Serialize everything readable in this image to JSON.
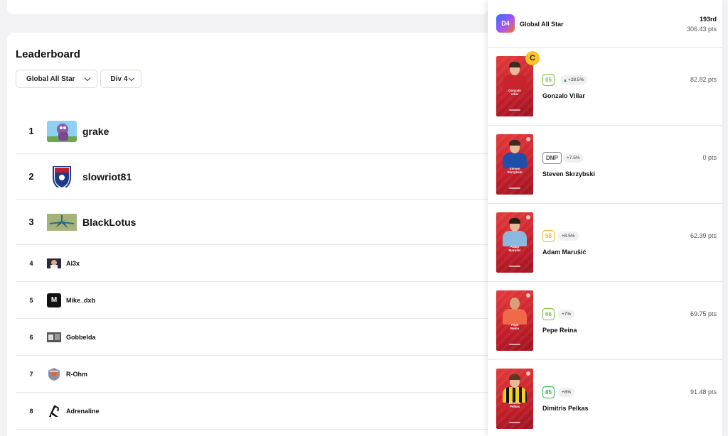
{
  "leaderboard": {
    "title": "Leaderboard",
    "filters": {
      "competition": "Global All Star",
      "division": "Div 4"
    },
    "rows": [
      {
        "rank": "1",
        "name": "grake"
      },
      {
        "rank": "2",
        "name": "slowriot81"
      },
      {
        "rank": "3",
        "name": "BlackLotus"
      },
      {
        "rank": "4",
        "name": "Al3x"
      },
      {
        "rank": "5",
        "name": "Mike_dxb",
        "avatar_letter": "M"
      },
      {
        "rank": "6",
        "name": "Gobbelda"
      },
      {
        "rank": "7",
        "name": "R-Ohm"
      },
      {
        "rank": "8",
        "name": "Adrenaline"
      }
    ]
  },
  "panel": {
    "badge": "D4",
    "competition": "Global All Star",
    "rank": "193rd",
    "points": "306.43 pts",
    "captain_label": "C",
    "players": [
      {
        "name": "Gonzalo Villar",
        "card_name": "Gonzalo\nVillar",
        "score": "65",
        "bonus": "+28.5%",
        "bonus_up": true,
        "points": "82.82 pts",
        "score_color": "#7cc242"
      },
      {
        "name": "Steven Skrzybski",
        "card_name": "Steven\nSkrzybski",
        "score": "DNP",
        "bonus": "+7.5%",
        "points": "0 pts",
        "score_color": "#8a8a8a"
      },
      {
        "name": "Adam Marušić",
        "card_name": "Adam\nMarušić",
        "score": "58",
        "bonus": "+8.5%",
        "points": "62.39 pts",
        "score_color": "#f5b731"
      },
      {
        "name": "Pepe Reina",
        "card_name": "Pepe\nReina",
        "score": "66",
        "bonus": "+7%",
        "points": "69.75 pts",
        "score_color": "#7cc242"
      },
      {
        "name": "Dimitris Pelkas",
        "card_name": "Dimitris\nPelkas",
        "score": "85",
        "bonus": "+8%",
        "points": "91.48 pts",
        "score_color": "#2fb34a"
      }
    ]
  },
  "colors": {
    "card_red": "#c41e2a",
    "captain_yellow": "#fbc32a",
    "chevron_blue": "#1e3a8a"
  }
}
